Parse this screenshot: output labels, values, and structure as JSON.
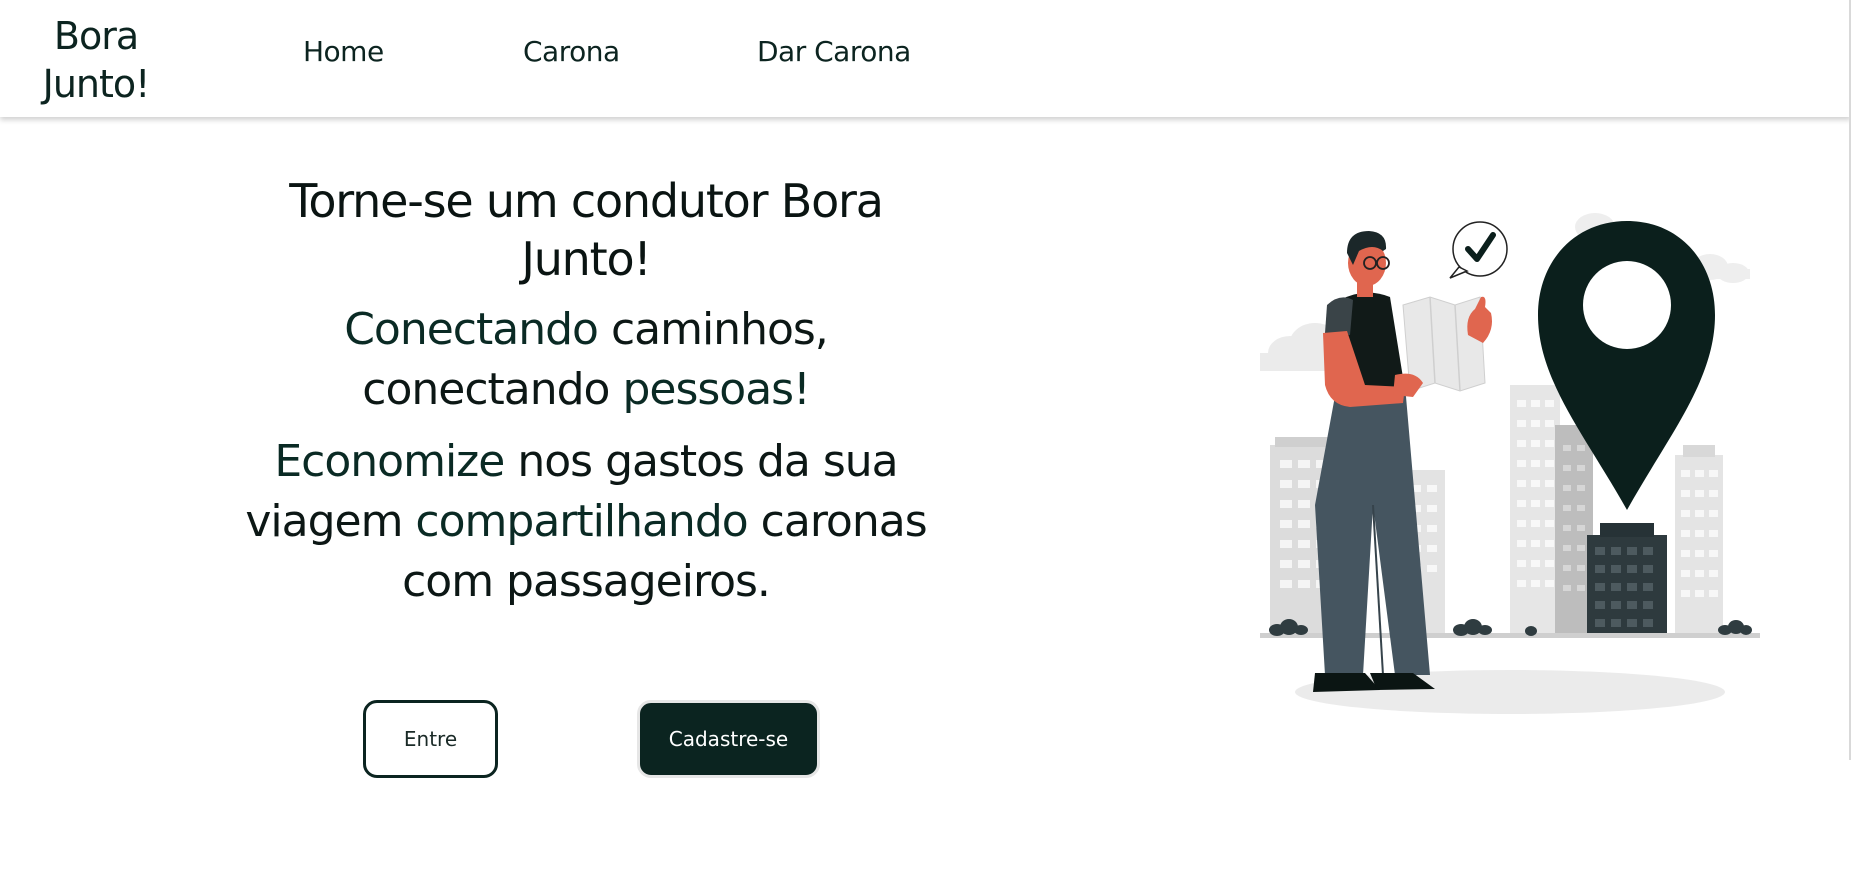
{
  "header": {
    "logo_line1": "Bora",
    "logo_line2": "Junto!",
    "nav": [
      {
        "label": "Home"
      },
      {
        "label": "Carona"
      },
      {
        "label": "Dar Carona"
      }
    ]
  },
  "hero": {
    "title_line1": "Torne-se um condutor Bora",
    "title_line2": "Junto!",
    "tagline": {
      "em1": "Conectando",
      "t1": " caminhos,",
      "t2": "conectando ",
      "em2": "pessoas!"
    },
    "pitch": {
      "em1": "Economize",
      "t1": " nos gastos da sua",
      "t2": "viagem ",
      "em2": "compartilhando",
      "t3": " caronas",
      "t4": "com passageiros."
    }
  },
  "buttons": {
    "login_label": "Entre",
    "signup_label": "Cadastre-se"
  },
  "colors": {
    "brand_dark": "#0b2420",
    "skin": "#e0664f",
    "pants": "#455560"
  },
  "illustration": {
    "icon": "map-pin-icon",
    "check_icon": "checkmark-icon"
  }
}
